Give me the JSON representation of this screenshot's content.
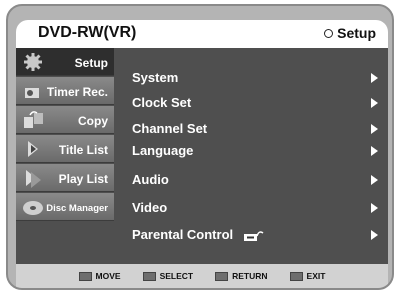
{
  "header": {
    "title": "DVD-RW(VR)",
    "section": "Setup"
  },
  "sidebar": {
    "items": [
      {
        "label": "Setup",
        "icon": "gear-icon"
      },
      {
        "label": "Timer Rec.",
        "icon": "timer-icon"
      },
      {
        "label": "Copy",
        "icon": "copy-icon"
      },
      {
        "label": "Title List",
        "icon": "title-list-icon"
      },
      {
        "label": "Play List",
        "icon": "play-list-icon"
      },
      {
        "label": "Disc Manager",
        "icon": "disc-icon"
      }
    ]
  },
  "menu": {
    "items": [
      {
        "label": "System"
      },
      {
        "label": "Clock Set"
      },
      {
        "label": "Channel Set"
      },
      {
        "label": "Language"
      },
      {
        "label": "Audio"
      },
      {
        "label": "Video"
      },
      {
        "label": "Parental Control"
      }
    ]
  },
  "footer": {
    "move": "MOVE",
    "select": "SELECT",
    "return": "RETURN",
    "exit": "EXIT"
  }
}
